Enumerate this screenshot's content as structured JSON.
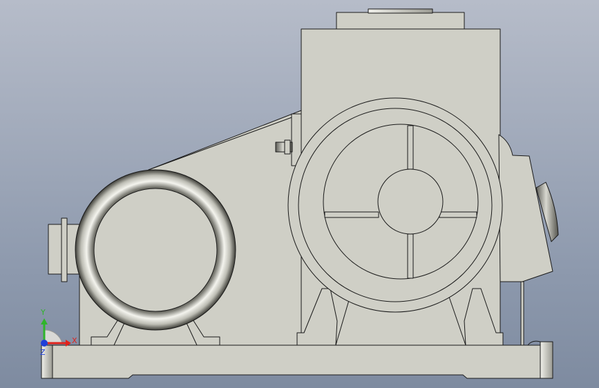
{
  "viewport": {
    "background_top": "#b6bcc9",
    "background_bottom": "#7e8ba0",
    "part_fill": "#cfcfc6",
    "edge_color": "#1a1a1a"
  },
  "triad": {
    "x_label": "X",
    "y_label": "Y",
    "z_label": "Z",
    "x_color": "#e0231c",
    "y_color": "#2fb52b",
    "z_color": "#1f3fd8"
  }
}
